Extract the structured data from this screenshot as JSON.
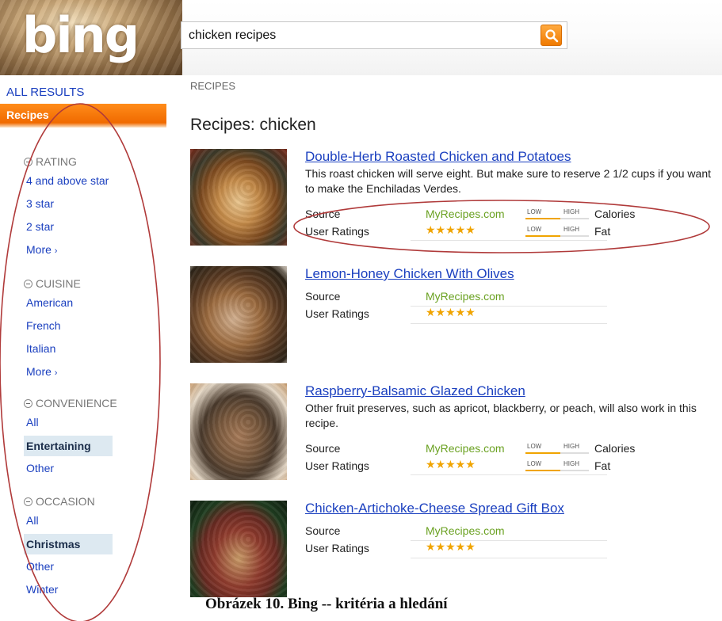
{
  "header": {
    "logo": "bing",
    "search": {
      "value": "chicken recipes",
      "button_icon": "search-magnifier-icon"
    }
  },
  "sidebar": {
    "all_results": "ALL RESULTS",
    "active_vertical": "Recipes",
    "facets": [
      {
        "title": "RATING",
        "items": [
          "4 and above star",
          "3 star",
          "2 star"
        ],
        "more": "More"
      },
      {
        "title": "CUISINE",
        "items": [
          "American",
          "French",
          "Italian"
        ],
        "more": "More"
      },
      {
        "title": "CONVENIENCE",
        "items": [
          "All",
          "Entertaining",
          "Other"
        ],
        "selected": "Entertaining"
      },
      {
        "title": "OCCASION",
        "items": [
          "All",
          "Christmas",
          "Other",
          "Winter"
        ],
        "selected": "Christmas"
      }
    ]
  },
  "main": {
    "section_label": "RECIPES",
    "heading": "Recipes: chicken",
    "labels": {
      "source": "Source",
      "ratings": "User Ratings",
      "low": "LOW",
      "high": "HIGH"
    },
    "recipes": [
      {
        "title": "Double-Herb Roasted Chicken and Potatoes",
        "description": "This roast chicken will serve eight. But make sure to reserve 2 1/2 cups if you want to make the Enchiladas Verdes.",
        "source": "MyRecipes.com",
        "rating": 5,
        "stars": "★★★★★",
        "calories_label": "Calories",
        "fat_label": "Fat",
        "calories_level": 0.55,
        "fat_level": 0.55
      },
      {
        "title": "Lemon-Honey Chicken With Olives",
        "source": "MyRecipes.com",
        "rating": 5,
        "stars": "★★★★★"
      },
      {
        "title": "Raspberry-Balsamic Glazed Chicken",
        "description": "Other fruit preserves, such as apricot, blackberry, or peach, will also work in this recipe.",
        "source": "MyRecipes.com",
        "rating": 5,
        "stars": "★★★★★",
        "calories_label": "Calories",
        "fat_label": "Fat",
        "calories_level": 0.55,
        "fat_level": 0.55
      },
      {
        "title": "Chicken-Artichoke-Cheese Spread Gift Box",
        "source": "MyRecipes.com",
        "rating": 5,
        "stars": "★★★★★"
      }
    ]
  },
  "caption": "Obrázek 10. Bing -- kritéria a hledání",
  "colors": {
    "accent": "#f07a00",
    "link": "#1a3fbf",
    "source": "#6aa121",
    "stars": "#f0a400",
    "annotation": "#b03a3a"
  }
}
